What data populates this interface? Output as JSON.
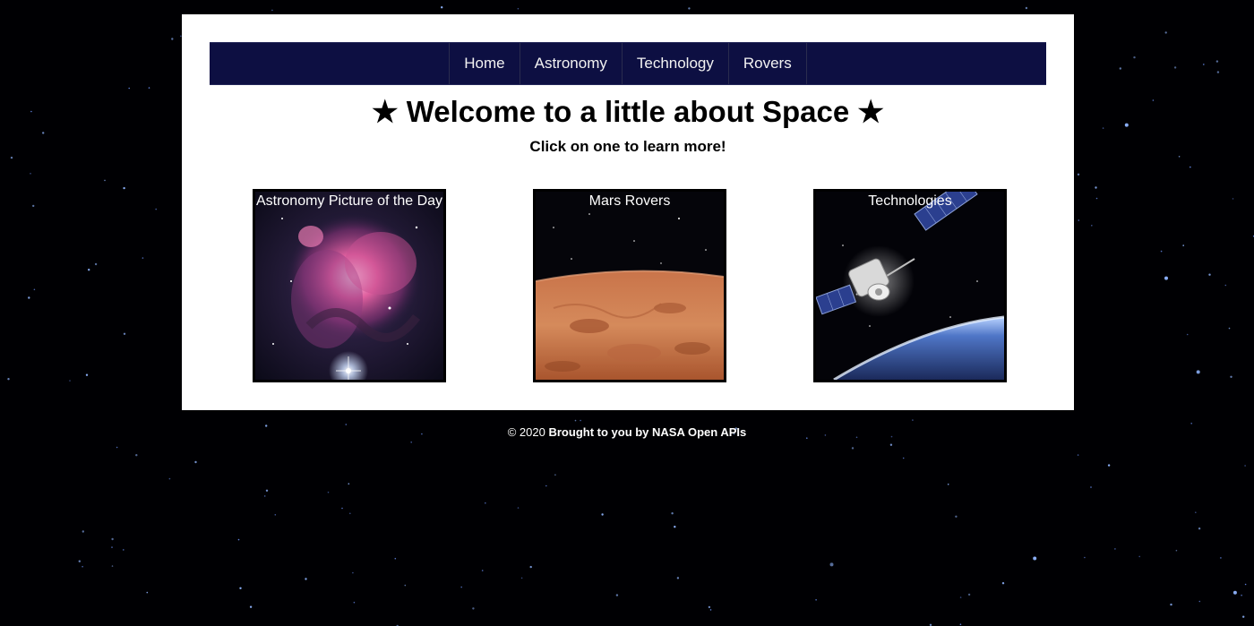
{
  "nav": {
    "items": [
      {
        "label": "Home"
      },
      {
        "label": "Astronomy"
      },
      {
        "label": "Technology"
      },
      {
        "label": "Rovers"
      }
    ]
  },
  "main": {
    "title": "★ Welcome to a little about Space ★",
    "subtitle": "Click on one to learn more!"
  },
  "cards": [
    {
      "label": "Astronomy Picture of the Day",
      "image": "orion-nebula"
    },
    {
      "label": "Mars Rovers",
      "image": "mars-surface"
    },
    {
      "label": "Technologies",
      "image": "satellite-over-earth"
    }
  ],
  "footer": {
    "copyright": "© 2020",
    "credit": "Brought to you by NASA Open APIs"
  },
  "colors": {
    "background": "#000003",
    "navbar": "#0d0f42",
    "card_border": "#000000"
  }
}
